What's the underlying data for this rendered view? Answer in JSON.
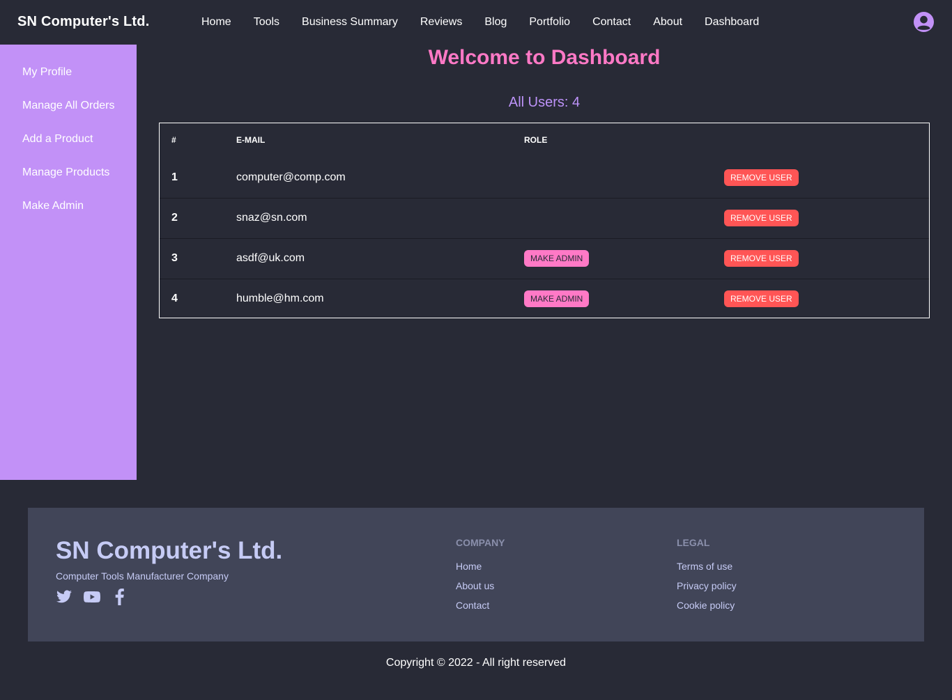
{
  "header": {
    "brand": "SN Computer's Ltd.",
    "nav": [
      "Home",
      "Tools",
      "Business Summary",
      "Reviews",
      "Blog",
      "Portfolio",
      "Contact",
      "About",
      "Dashboard"
    ],
    "avatar_icon": "user-circle-icon"
  },
  "sidebar": {
    "items": [
      {
        "label": "My Profile"
      },
      {
        "label": "Manage All Orders"
      },
      {
        "label": "Add a Product"
      },
      {
        "label": "Manage Products"
      },
      {
        "label": "Make Admin"
      }
    ]
  },
  "main": {
    "title": "Welcome to Dashboard",
    "users_count": "All Users: 4",
    "table": {
      "headers": [
        "#",
        "E-mail",
        "Role",
        ""
      ],
      "rows": [
        {
          "num": "1",
          "email": "computer@comp.com",
          "make_admin": "",
          "remove": "Remove User"
        },
        {
          "num": "2",
          "email": "snaz@sn.com",
          "make_admin": "",
          "remove": "Remove User"
        },
        {
          "num": "3",
          "email": "asdf@uk.com",
          "make_admin": "Make Admin",
          "remove": "Remove User"
        },
        {
          "num": "4",
          "email": "humble@hm.com",
          "make_admin": "Make Admin",
          "remove": "Remove User"
        }
      ]
    }
  },
  "footer": {
    "brand": "SN Computer's Ltd.",
    "tagline": "Computer Tools Manufacturer Company",
    "social_icons": [
      "twitter-icon",
      "youtube-icon",
      "facebook-icon"
    ],
    "company": {
      "title": "Company",
      "links": [
        "Home",
        "About us",
        "Contact"
      ]
    },
    "legal": {
      "title": "Legal",
      "links": [
        "Terms of use",
        "Privacy policy",
        "Cookie policy"
      ]
    },
    "copyright": "Copyright © 2022 - All right reserved"
  },
  "colors": {
    "background": "#282a36",
    "sidebar": "#c291f7",
    "title": "#ff79c6",
    "accent": "#bd93f9",
    "remove_button": "#ff5555",
    "admin_button": "#ff79c6",
    "footer": "#414558"
  }
}
